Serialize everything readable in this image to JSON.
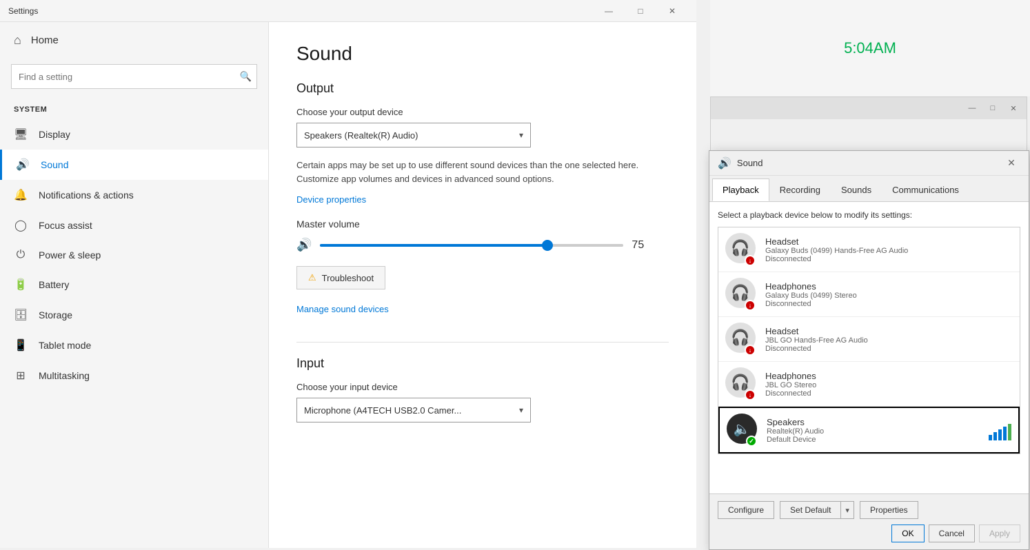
{
  "settings_window": {
    "title": "Settings",
    "search_placeholder": "Find a setting",
    "search_icon": "🔍",
    "home_label": "Home",
    "home_icon": "⌂",
    "section_label": "System",
    "nav_items": [
      {
        "id": "display",
        "icon": "🖥",
        "label": "Display"
      },
      {
        "id": "sound",
        "icon": "🔊",
        "label": "Sound",
        "active": true
      },
      {
        "id": "notifications",
        "icon": "🔔",
        "label": "Notifications & actions"
      },
      {
        "id": "focus",
        "icon": "◯",
        "label": "Focus assist"
      },
      {
        "id": "power",
        "icon": "⏻",
        "label": "Power & sleep"
      },
      {
        "id": "battery",
        "icon": "🔋",
        "label": "Battery"
      },
      {
        "id": "storage",
        "icon": "🗄",
        "label": "Storage"
      },
      {
        "id": "tablet",
        "icon": "📱",
        "label": "Tablet mode"
      },
      {
        "id": "multitasking",
        "icon": "⊞",
        "label": "Multitasking"
      }
    ],
    "titlebar_controls": {
      "minimize": "—",
      "maximize": "□",
      "close": "✕"
    }
  },
  "main_content": {
    "page_title": "Sound",
    "output_section": {
      "title": "Output",
      "choose_device_label": "Choose your output device",
      "selected_device": "Speakers (Realtek(R) Audio)",
      "info_text": "Certain apps may be set up to use different sound devices than the one selected here. Customize app volumes and devices in advanced sound options.",
      "device_properties_link": "Device properties",
      "master_volume_label": "Master volume",
      "volume_value": "75",
      "troubleshoot_btn": "Troubleshoot",
      "manage_devices_link": "Manage sound devices"
    },
    "input_section": {
      "title": "Input",
      "choose_device_label": "Choose your input device",
      "selected_device": "Microphone (A4TECH USB2.0 Camer..."
    }
  },
  "clock": {
    "time": "5:04AM"
  },
  "sound_dialog": {
    "title": "Sound",
    "icon": "🔊",
    "close_btn": "✕",
    "tabs": [
      {
        "id": "playback",
        "label": "Playback",
        "active": true
      },
      {
        "id": "recording",
        "label": "Recording"
      },
      {
        "id": "sounds",
        "label": "Sounds"
      },
      {
        "id": "communications",
        "label": "Communications"
      }
    ],
    "instruction": "Select a playback device below to modify its settings:",
    "devices": [
      {
        "id": "headset-galaxy-hf",
        "icon": "🎧",
        "name": "Headset",
        "sub": "Galaxy Buds (0499) Hands-Free AG Audio",
        "status": "Disconnected",
        "connected": false,
        "selected": false,
        "is_default": false
      },
      {
        "id": "headphones-galaxy",
        "icon": "🎧",
        "name": "Headphones",
        "sub": "Galaxy Buds (0499) Stereo",
        "status": "Disconnected",
        "connected": false,
        "selected": false,
        "is_default": false
      },
      {
        "id": "headset-jbl-hf",
        "icon": "🎧",
        "name": "Headset",
        "sub": "JBL GO Hands-Free AG Audio",
        "status": "Disconnected",
        "connected": false,
        "selected": false,
        "is_default": false
      },
      {
        "id": "headphones-jbl",
        "icon": "🎧",
        "name": "Headphones",
        "sub": "JBL GO Stereo",
        "status": "Disconnected",
        "connected": false,
        "selected": false,
        "is_default": false
      },
      {
        "id": "speakers-realtek",
        "icon": "🔈",
        "name": "Speakers",
        "sub": "Realtek(R) Audio",
        "status": "Default Device",
        "connected": true,
        "selected": true,
        "is_default": true
      }
    ],
    "footer_buttons": {
      "configure": "Configure",
      "set_default": "Set Default",
      "set_default_arrow": "▾",
      "properties": "Properties",
      "ok": "OK",
      "cancel": "Cancel",
      "apply": "Apply"
    },
    "bg_window_controls": {
      "minimize": "—",
      "maximize": "□",
      "close": "✕"
    }
  }
}
